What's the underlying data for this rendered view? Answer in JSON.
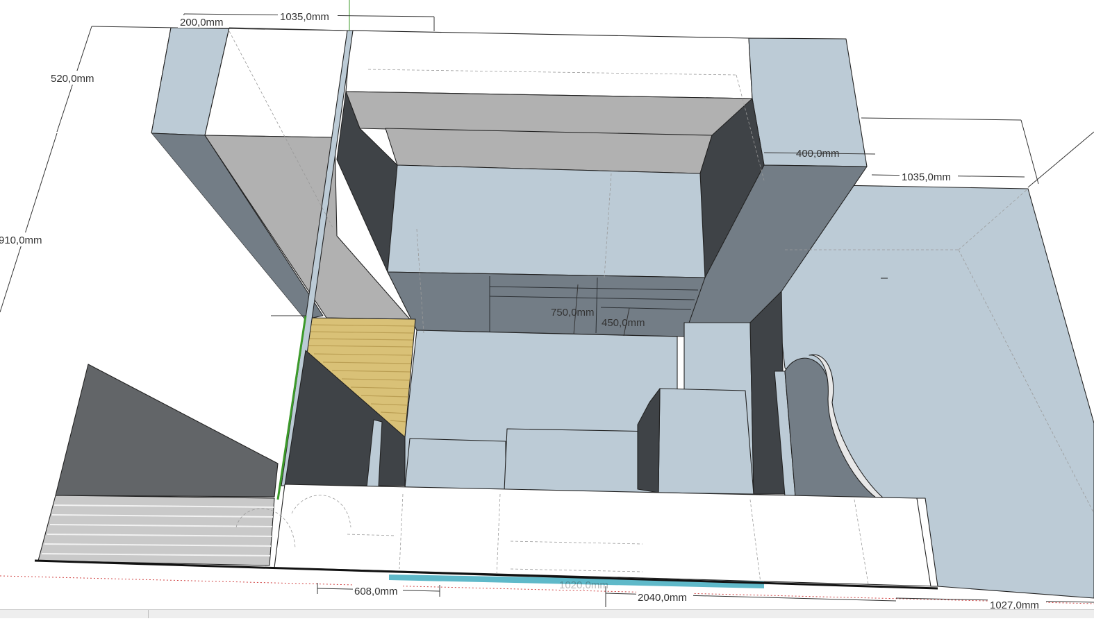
{
  "model": {
    "colors": {
      "panel_light": "#bccbd6",
      "panel_mid": "#737d86",
      "panel_dark": "#3f4347",
      "panel_grey": "#b1b1b1",
      "panel_white": "#ffffff",
      "wood": "#d9c177",
      "carpet": "#c9c9c9",
      "axis_green": "#3c9a2a",
      "axis_red": "#d04040",
      "floor_blue": "#5fb9c9"
    },
    "dimensions": [
      {
        "id": "dim-width-top",
        "label": "1035,0mm"
      },
      {
        "id": "dim-top-small",
        "label": "200,0mm"
      },
      {
        "id": "dim-depth-left",
        "label": "520,0mm"
      },
      {
        "id": "dim-height-left",
        "label": "910,0mm"
      },
      {
        "id": "dim-shelf-width",
        "label": "400,0mm"
      },
      {
        "id": "dim-width-right",
        "label": "1035,0mm"
      },
      {
        "id": "dim-inner-height",
        "label": "750,0mm"
      },
      {
        "id": "dim-inner-small",
        "label": "450,0mm"
      },
      {
        "id": "dim-bottom-left",
        "label": "608,0mm"
      },
      {
        "id": "dim-bottom-hidden",
        "label": "1020,0mm"
      },
      {
        "id": "dim-bottom-total",
        "label": "2040,0mm"
      },
      {
        "id": "dim-bottom-right",
        "label": "1027,0mm"
      }
    ]
  }
}
